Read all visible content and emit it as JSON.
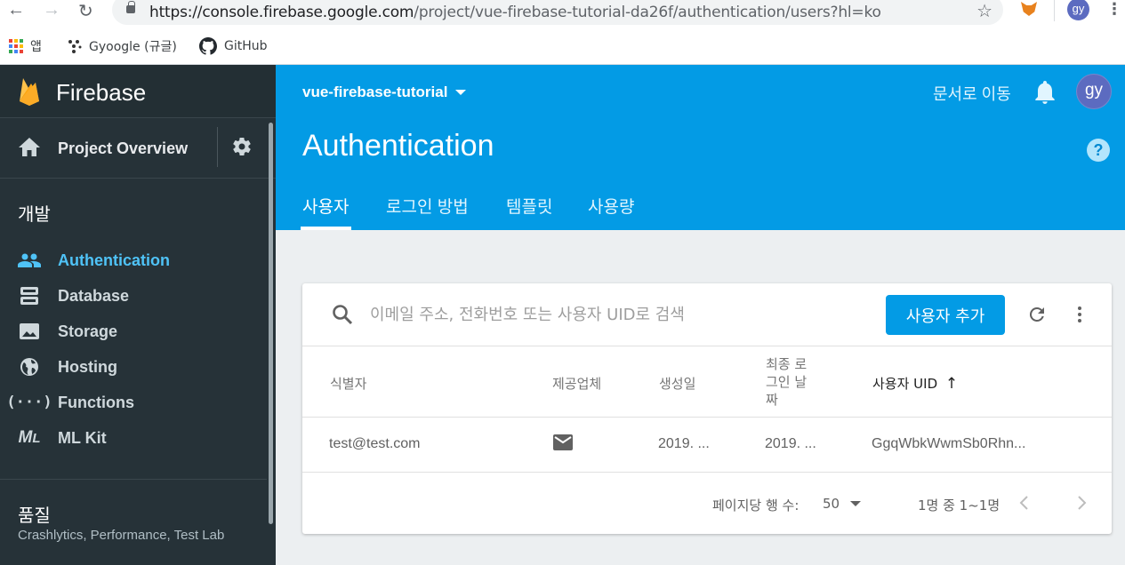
{
  "browser": {
    "url_host": "https://console.firebase.google.com",
    "url_path": "/project/vue-firebase-tutorial-da26f/authentication/users?hl=ko",
    "avatar": "gy",
    "bookmarks": [
      {
        "label": "앱",
        "icon": "apps-icon"
      },
      {
        "label": "Gyoogle (규글)",
        "icon": "dots-icon"
      },
      {
        "label": "GitHub",
        "icon": "github-icon"
      }
    ]
  },
  "sidebar": {
    "brand": "Firebase",
    "overview": "Project Overview",
    "sections": {
      "develop": "개발",
      "quality": "품질",
      "quality_sub": "Crashlytics, Performance, Test Lab"
    },
    "items": [
      {
        "label": "Authentication",
        "icon": "people-icon",
        "active": true
      },
      {
        "label": "Database",
        "icon": "database-icon",
        "active": false
      },
      {
        "label": "Storage",
        "icon": "image-icon",
        "active": false
      },
      {
        "label": "Hosting",
        "icon": "globe-icon",
        "active": false
      },
      {
        "label": "Functions",
        "icon": "functions-icon",
        "active": false
      },
      {
        "label": "ML Kit",
        "icon": "mlkit-icon",
        "active": false
      }
    ]
  },
  "header": {
    "project": "vue-firebase-tutorial",
    "docs": "문서로 이동",
    "avatar": "gy",
    "help": "?",
    "title": "Authentication",
    "tabs": [
      "사용자",
      "로그인 방법",
      "템플릿",
      "사용량"
    ]
  },
  "users": {
    "search_placeholder": "이메일 주소, 전화번호 또는 사용자 UID로 검색",
    "add_button": "사용자 추가",
    "columns": {
      "identifier": "식별자",
      "provider": "제공업체",
      "created": "생성일",
      "last_signin": [
        "최종 로",
        "그인 날",
        "짜"
      ],
      "uid": "사용자 UID"
    },
    "rows": [
      {
        "identifier": "test@test.com",
        "provider": "mail-icon",
        "created": "2019. ...",
        "last_signin": "2019. ...",
        "uid": "GgqWbkWwmSb0Rhn..."
      }
    ],
    "footer": {
      "rows_per_page_label": "페이지당 행 수:",
      "rows_per_page": "50",
      "range": "1명 중 1~1명"
    }
  },
  "colors": {
    "header_bg": "#039be5",
    "sidebar_bg": "#263238",
    "active_nav": "#4fc3f7",
    "avatar_bg": "#5c6bc0"
  }
}
